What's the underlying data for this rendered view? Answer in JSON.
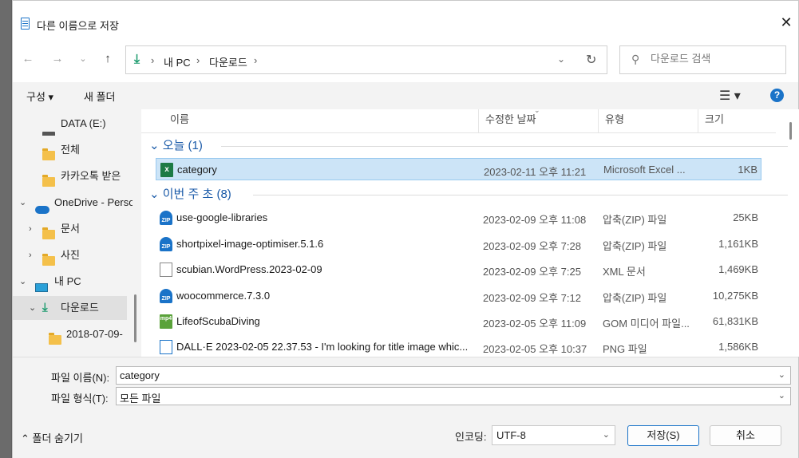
{
  "dialog": {
    "title": "다른 이름으로 저장",
    "close_icon": "close-icon"
  },
  "navigation": {
    "back": "←",
    "forward": "→",
    "recent": "⌄",
    "up": "↑",
    "address_crumbs": [
      "내 PC",
      "다운로드"
    ],
    "address_sep": "›",
    "search_placeholder": "다운로드 검색"
  },
  "toolbar": {
    "organize": "구성 ▾",
    "new_folder": "새 폴더",
    "help": "?"
  },
  "nav_pane": {
    "items": [
      {
        "label": "DATA (E:)",
        "icon": "drive-icon",
        "indent": 1,
        "chevron": ""
      },
      {
        "label": "전체",
        "icon": "folder-icon",
        "indent": 1,
        "chevron": ""
      },
      {
        "label": "카카오톡 받은",
        "icon": "folder-icon",
        "indent": 1,
        "chevron": ""
      },
      {
        "label": "OneDrive - Perso",
        "icon": "cloud-icon",
        "indent": 0,
        "chevron": "⌄"
      },
      {
        "label": "문서",
        "icon": "folder-icon",
        "indent": 1,
        "chevron": "›"
      },
      {
        "label": "사진",
        "icon": "folder-icon",
        "indent": 1,
        "chevron": "›"
      },
      {
        "label": "내 PC",
        "icon": "pc-icon",
        "indent": 0,
        "chevron": "⌄"
      },
      {
        "label": "다운로드",
        "icon": "download-icon",
        "indent": 1,
        "chevron": "⌄",
        "selected": true
      },
      {
        "label": "2018-07-09-",
        "icon": "folder-icon",
        "indent": 2,
        "chevron": ""
      }
    ]
  },
  "file_list": {
    "columns": [
      "이름",
      "수정한 날짜",
      "유형",
      "크기"
    ],
    "groups": [
      {
        "label": "오늘 (1)",
        "rows": [
          {
            "name": "category",
            "date": "2023-02-11 오후 11:21",
            "type": "Microsoft Excel ...",
            "size": "1KB",
            "icon": "excel",
            "selected": true
          }
        ]
      },
      {
        "label": "이번 주 초 (8)",
        "rows": [
          {
            "name": "use-google-libraries",
            "date": "2023-02-09 오후 11:08",
            "type": "압축(ZIP) 파일",
            "size": "25KB",
            "icon": "zip"
          },
          {
            "name": "shortpixel-image-optimiser.5.1.6",
            "date": "2023-02-09 오후 7:28",
            "type": "압축(ZIP) 파일",
            "size": "1,161KB",
            "icon": "zip"
          },
          {
            "name": "scubian.WordPress.2023-02-09",
            "date": "2023-02-09 오후 7:25",
            "type": "XML 문서",
            "size": "1,469KB",
            "icon": "file"
          },
          {
            "name": "woocommerce.7.3.0",
            "date": "2023-02-09 오후 7:12",
            "type": "압축(ZIP) 파일",
            "size": "10,275KB",
            "icon": "zip"
          },
          {
            "name": "LifeofScubaDiving",
            "date": "2023-02-05 오후 11:09",
            "type": "GOM 미디어 파일...",
            "size": "61,831KB",
            "icon": "mp4"
          },
          {
            "name": "DALL·E 2023-02-05 22.37.53 - I'm looking for title image whic...",
            "date": "2023-02-05 오후 10:37",
            "type": "PNG 파일",
            "size": "1,586KB",
            "icon": "png"
          }
        ]
      }
    ]
  },
  "bottom": {
    "filename_label": "파일 이름(N):",
    "filename_value": "category",
    "filetype_label": "파일 형식(T):",
    "filetype_value": "모든 파일",
    "hide_folders": "⌃  폴더 숨기기",
    "encoding_label": "인코딩:",
    "encoding_value": "UTF-8",
    "save_button": "저장(S)",
    "cancel_button": "취소"
  }
}
